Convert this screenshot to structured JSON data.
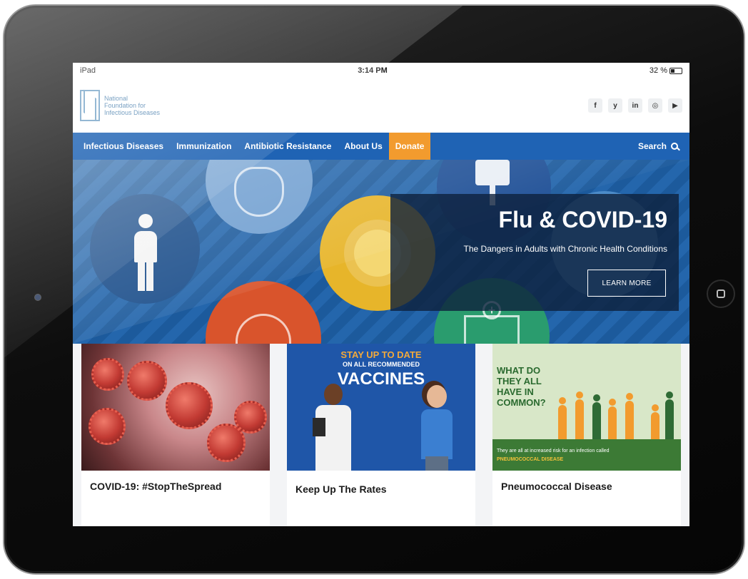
{
  "device": {
    "status": {
      "carrier": "iPad",
      "time": "3:14 PM",
      "battery": "32 %"
    }
  },
  "site": {
    "logo_text": "National Foundation for Infectious Diseases",
    "social": [
      {
        "icon": "facebook-icon",
        "glyph": "f"
      },
      {
        "icon": "twitter-icon",
        "glyph": "y"
      },
      {
        "icon": "linkedin-icon",
        "glyph": "in"
      },
      {
        "icon": "instagram-icon",
        "glyph": "◎"
      },
      {
        "icon": "youtube-icon",
        "glyph": "▶"
      }
    ],
    "nav": {
      "items": [
        {
          "label": "Infectious Diseases"
        },
        {
          "label": "Immunization"
        },
        {
          "label": "Antibiotic Resistance"
        },
        {
          "label": "About Us"
        },
        {
          "label": "Donate"
        }
      ],
      "search_label": "Search"
    },
    "hero": {
      "title": "Flu & COVID-19",
      "subtitle": "The Dangers in Adults with Chronic Health Conditions",
      "button": "LEARN MORE"
    },
    "cards": [
      {
        "title": "COVID-19: #StopTheSpread"
      },
      {
        "title": "Keep Up The Rates",
        "image_line1": "STAY UP TO DATE",
        "image_line2": "ON ALL RECOMMENDED",
        "image_line3": "VACCINES"
      },
      {
        "title": "Pneumococcal Disease",
        "image_question": "WHAT DO THEY ALL HAVE IN COMMON?",
        "image_caption": "They are all at increased risk for an infection called",
        "image_caption_highlight": "PNEUMOCOCCAL DISEASE"
      }
    ]
  },
  "colors": {
    "nav_blue": "#1f63b4",
    "donate_orange": "#f29b2e",
    "hero_blue": "#1c5a9c",
    "panel_dark": "#0e203c",
    "pneumo_green": "#3c7a35"
  }
}
